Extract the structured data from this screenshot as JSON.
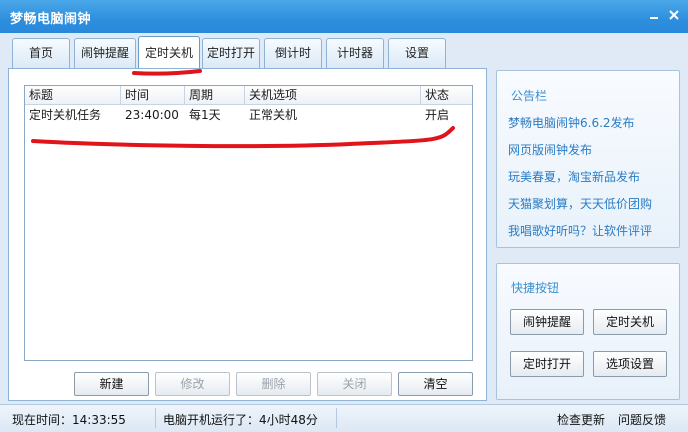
{
  "window": {
    "title": "梦畅电脑闹钟"
  },
  "tabs": [
    {
      "label": "首页"
    },
    {
      "label": "闹钟提醒"
    },
    {
      "label": "定时关机"
    },
    {
      "label": "定时打开"
    },
    {
      "label": "倒计时"
    },
    {
      "label": "计时器"
    },
    {
      "label": "设置"
    }
  ],
  "table": {
    "columns": [
      "标题",
      "时间",
      "周期",
      "关机选项",
      "状态"
    ],
    "rows": [
      {
        "title": "定时关机任务",
        "time": "23:40:00",
        "cycle": "每1天",
        "option": "正常关机",
        "status": "开启"
      }
    ]
  },
  "actions": {
    "new": "新建",
    "edit": "修改",
    "delete": "删除",
    "close": "关闭",
    "clear": "清空"
  },
  "notice": {
    "heading": "公告栏",
    "links": [
      "梦畅电脑闹钟6.6.2发布",
      "网页版闹钟发布",
      "玩美春夏，淘宝新品发布",
      "天猫聚划算，天天低价团购",
      "我唱歌好听吗？让软件评评"
    ]
  },
  "quick": {
    "heading": "快捷按钮",
    "buttons": [
      "闹钟提醒",
      "定时关机",
      "定时打开",
      "选项设置"
    ]
  },
  "status": {
    "time": "现在时间：14:33:55",
    "uptime": "电脑开机运行了：4小时48分",
    "check_update": "检查更新",
    "feedback": "问题反馈"
  },
  "colors": {
    "titlebar": "#2e8fde",
    "link": "#2a7cc4",
    "annotation": "#e0141a"
  }
}
